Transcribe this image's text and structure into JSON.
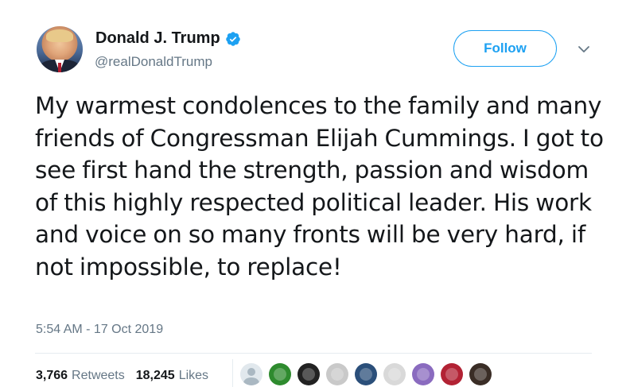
{
  "author": {
    "name": "Donald J. Trump",
    "handle": "@realDonaldTrump",
    "verified": true,
    "verified_color": "#1da1f2"
  },
  "actions": {
    "follow_label": "Follow",
    "more_icon": "chevron-down-icon"
  },
  "tweet": {
    "text": "My warmest condolences to the family and many friends of Congressman Elijah Cummings. I got to see first hand the strength, passion and wisdom of this highly respected political leader. His work and voice on so many fronts will be very hard, if not impossible, to replace!",
    "timestamp": "5:54 AM - 17 Oct 2019"
  },
  "stats": {
    "retweets_count": "3,766",
    "retweets_label": "Retweets",
    "likes_count": "18,245",
    "likes_label": "Likes"
  },
  "likers": [
    {
      "icon": "default-profile-icon",
      "color": "#aab8c2"
    },
    {
      "icon": "green-logo-avatar",
      "color": "#2e8b2e"
    },
    {
      "icon": "dark-emblem-avatar",
      "color": "#222222"
    },
    {
      "icon": "joker-face-avatar",
      "color": "#c9c9c9"
    },
    {
      "icon": "blue-sphere-avatar",
      "color": "#2b4f7a"
    },
    {
      "icon": "text-graphic-avatar",
      "color": "#d9d9d9"
    },
    {
      "icon": "purple-face-avatar",
      "color": "#8a6bbf"
    },
    {
      "icon": "us-flag-map-avatar",
      "color": "#b22234"
    },
    {
      "icon": "portrait-photo-avatar",
      "color": "#3a2d26"
    }
  ]
}
